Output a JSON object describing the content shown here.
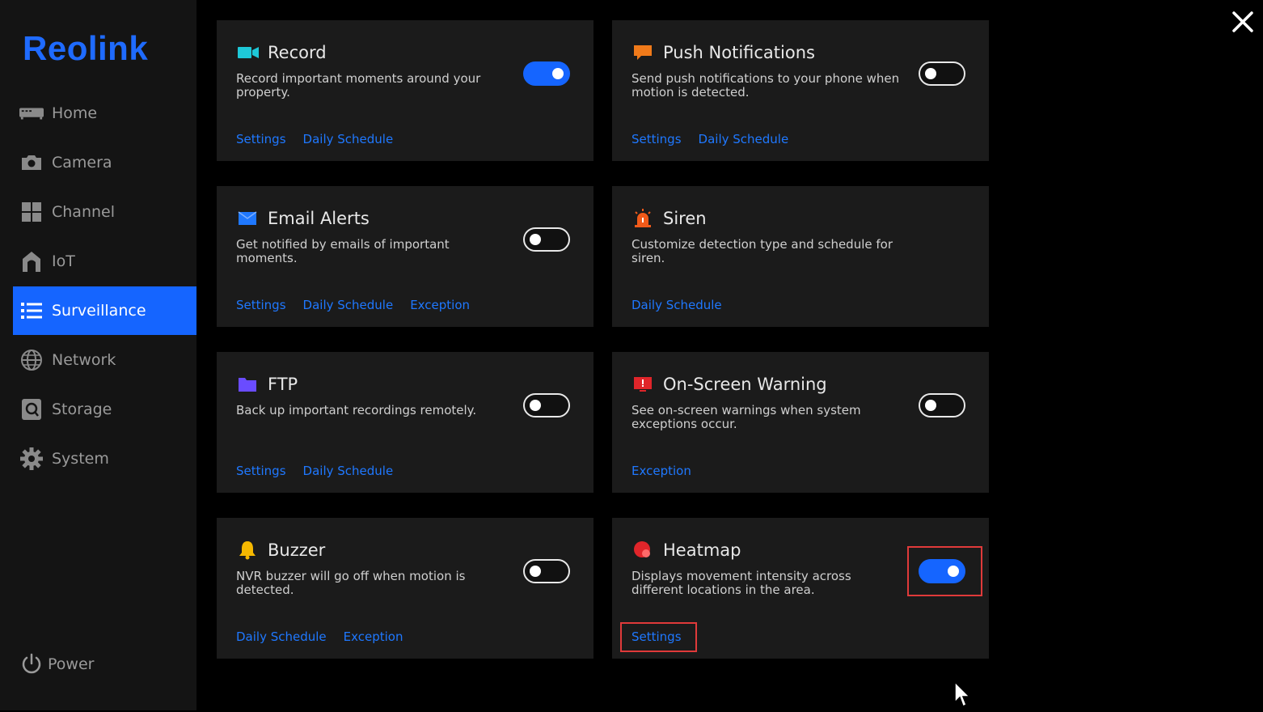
{
  "sidebar": {
    "logo": "Reolink",
    "items": [
      {
        "label": "Home",
        "icon": "home-icon"
      },
      {
        "label": "Camera",
        "icon": "camera-icon"
      },
      {
        "label": "Channel",
        "icon": "channel-icon"
      },
      {
        "label": "IoT",
        "icon": "iot-icon"
      },
      {
        "label": "Surveillance",
        "icon": "list-icon",
        "active": true
      },
      {
        "label": "Network",
        "icon": "globe-icon"
      },
      {
        "label": "Storage",
        "icon": "storage-icon"
      },
      {
        "label": "System",
        "icon": "gear-icon"
      }
    ],
    "power_label": "Power"
  },
  "colors": {
    "accent": "#1565ff",
    "link": "#1f78ff",
    "highlight": "#e03a3a"
  },
  "cards": [
    {
      "title": "Record",
      "desc": "Record important moments around your property.",
      "enabled": true,
      "links": [
        "Settings",
        "Daily Schedule"
      ]
    },
    {
      "title": "Push Notifications",
      "desc": "Send push notifications to your phone when motion is detected.",
      "enabled": false,
      "links": [
        "Settings",
        "Daily Schedule"
      ]
    },
    {
      "title": "Email Alerts",
      "desc": "Get notified by emails of important moments.",
      "enabled": false,
      "links": [
        "Settings",
        "Daily Schedule",
        "Exception"
      ]
    },
    {
      "title": "Siren",
      "desc": "Customize detection type and schedule for siren.",
      "links": [
        "Daily Schedule"
      ]
    },
    {
      "title": "FTP",
      "desc": "Back up important recordings remotely.",
      "enabled": false,
      "links": [
        "Settings",
        "Daily Schedule"
      ]
    },
    {
      "title": "On-Screen Warning",
      "desc": "See on-screen warnings when system exceptions occur.",
      "enabled": false,
      "links": [
        "Exception"
      ]
    },
    {
      "title": "Buzzer",
      "desc": "NVR buzzer will go off when motion is detected.",
      "enabled": false,
      "links": [
        "Daily Schedule",
        "Exception"
      ]
    },
    {
      "title": "Heatmap",
      "desc": "Displays movement intensity across different locations in the area.",
      "enabled": true,
      "links": [
        "Settings"
      ]
    }
  ]
}
